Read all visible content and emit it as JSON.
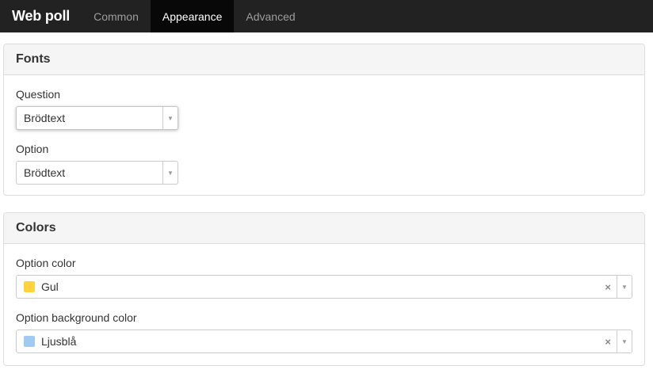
{
  "navbar": {
    "brand": "Web poll",
    "tabs": [
      {
        "label": "Common",
        "active": false
      },
      {
        "label": "Appearance",
        "active": true
      },
      {
        "label": "Advanced",
        "active": false
      }
    ]
  },
  "fonts": {
    "heading": "Fonts",
    "question": {
      "label": "Question",
      "value": "Brödtext"
    },
    "option": {
      "label": "Option",
      "value": "Brödtext"
    }
  },
  "colors": {
    "heading": "Colors",
    "option_color": {
      "label": "Option color",
      "value": "Gul",
      "swatch": "#fdd43d"
    },
    "option_background_color": {
      "label": "Option background color",
      "value": "Ljusblå",
      "swatch": "#9fcbf0"
    }
  },
  "icons": {
    "arrow": "▼",
    "clear": "×"
  }
}
